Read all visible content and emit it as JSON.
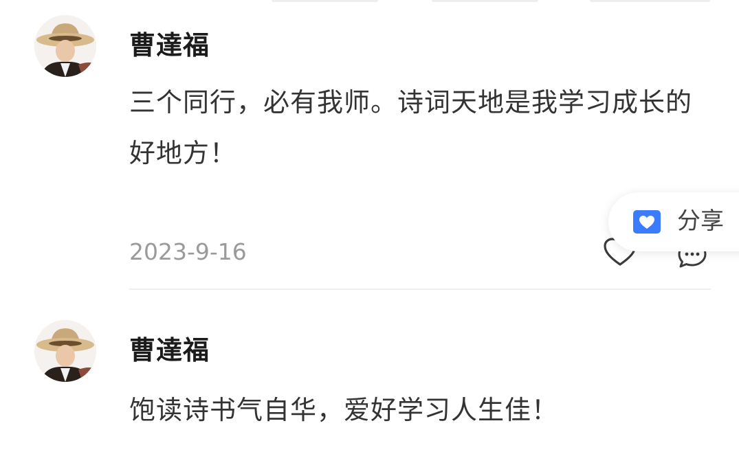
{
  "comments": [
    {
      "username": "曹達福",
      "content": "三个同行，必有我师。诗词天地是我学习成长的好地方！",
      "date": "2023-9-16"
    },
    {
      "username": "曹達福",
      "content": "饱读诗书气自华，爱好学习人生佳！"
    }
  ],
  "share_popup": {
    "label": "分享",
    "icon": "heart-envelope-icon"
  },
  "actions": {
    "like_icon": "heart-outline-icon",
    "comment_icon": "chat-bubble-icon"
  },
  "colors": {
    "text_primary": "#1b1b1b",
    "text_body": "#333333",
    "text_muted": "#9a9a9a",
    "share_blue": "#3b7cff",
    "divider": "#eeeeee"
  }
}
